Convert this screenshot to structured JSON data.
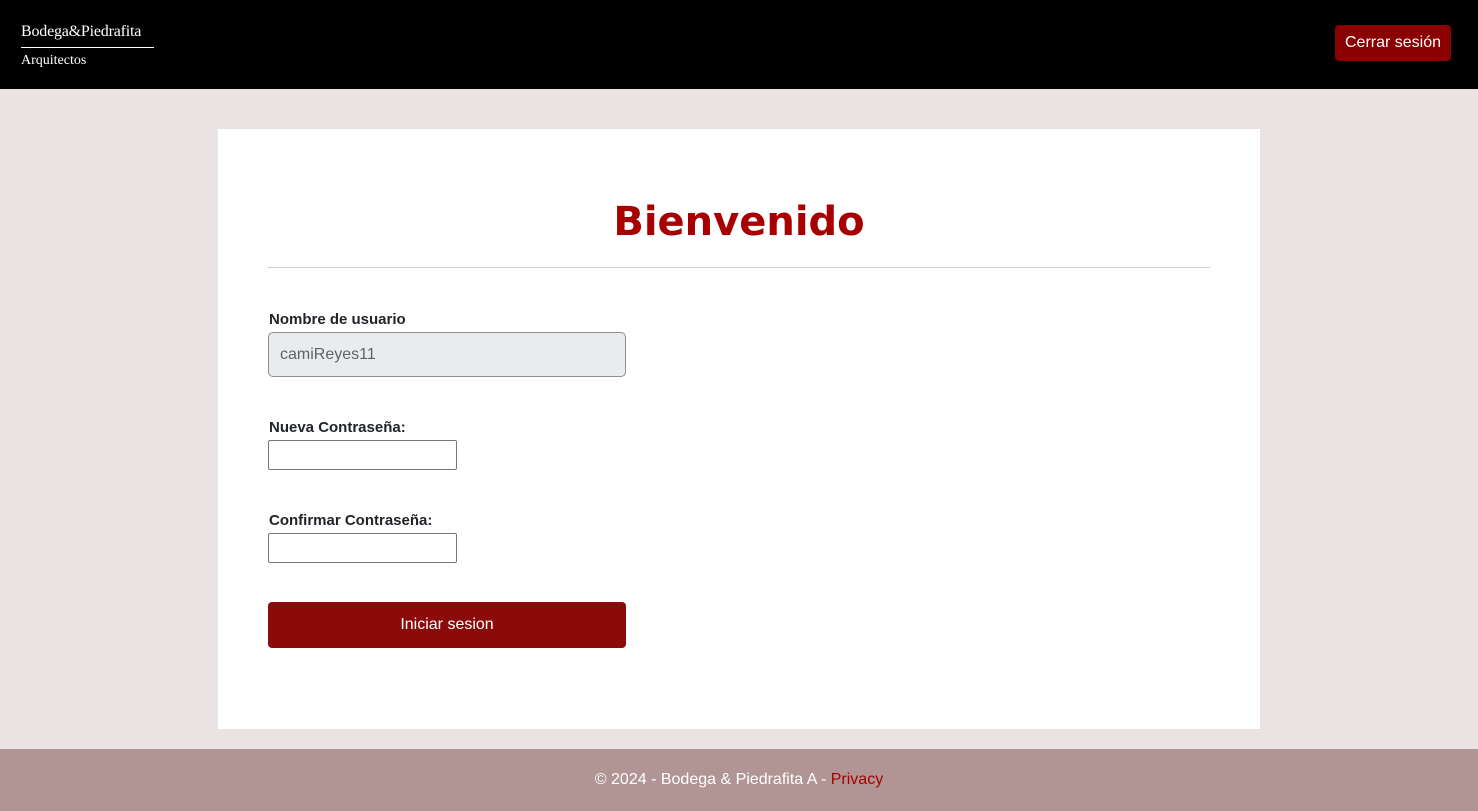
{
  "header": {
    "logo_top": "Bodega&Piedrafita",
    "logo_bottom": "Arquitectos",
    "logout_label": "Cerrar sesión"
  },
  "main": {
    "title": "Bienvenido",
    "username_label": "Nombre de usuario",
    "username_value": "camiReyes11",
    "new_password_label": "Nueva Contraseña:",
    "new_password_value": "",
    "confirm_password_label": "Confirmar Contraseña:",
    "confirm_password_value": "",
    "submit_label": "Iniciar sesion"
  },
  "footer": {
    "copyright": "© 2024 - Bodega & Piedrafita A - ",
    "privacy_link": "Privacy"
  },
  "colors": {
    "accent": "#8b0000",
    "title": "#a80000",
    "page_bg": "#e9e3e3",
    "footer_bg": "#b19595",
    "header_bg": "#000000"
  }
}
